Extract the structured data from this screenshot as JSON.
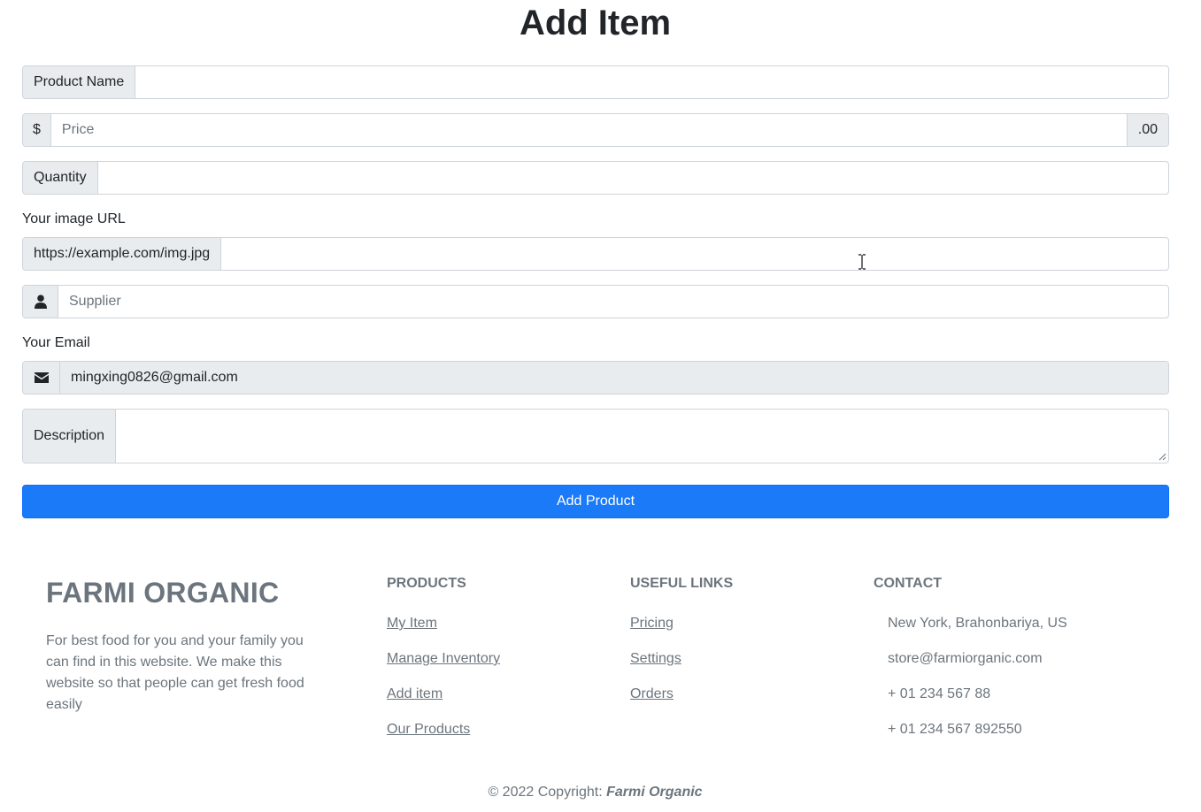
{
  "page": {
    "title": "Add Item"
  },
  "form": {
    "product_name": {
      "addon": "Product Name",
      "value": "",
      "placeholder": ""
    },
    "price": {
      "prefix": "$",
      "placeholder": "Price",
      "suffix": ".00",
      "value": ""
    },
    "quantity": {
      "addon": "Quantity",
      "value": "",
      "placeholder": ""
    },
    "image": {
      "label": "Your image URL",
      "addon": "https://example.com/img.jpg",
      "value": ""
    },
    "supplier": {
      "icon": "user-icon",
      "placeholder": "Supplier",
      "value": ""
    },
    "email": {
      "label": "Your Email",
      "icon": "envelope-icon",
      "value": "mingxing0826@gmail.com"
    },
    "description": {
      "addon": "Description",
      "value": ""
    },
    "submit_label": "Add Product"
  },
  "footer": {
    "brand": "FARMI ORGANIC",
    "about": "For best food for you and your family you can find in this website. We make this website so that people can get fresh food easily",
    "products": {
      "heading": "PRODUCTS",
      "links": [
        "My Item",
        "Manage Inventory",
        "Add item",
        "Our Products"
      ]
    },
    "useful_links": {
      "heading": "USEFUL LINKS",
      "links": [
        "Pricing",
        "Settings",
        "Orders"
      ]
    },
    "contact": {
      "heading": "CONTACT",
      "items": [
        "New York, Brahonbariya, US",
        "store@farmiorganic.com",
        "+ 01 234 567 88",
        "+ 01 234 567 892550"
      ]
    },
    "copyright": {
      "prefix": "© 2022 Copyright: ",
      "name": "Farmi Organic"
    }
  },
  "colors": {
    "primary": "#1a7af8",
    "muted": "#6c757d",
    "addon_bg": "#e9ecef",
    "border": "#ced4da"
  }
}
